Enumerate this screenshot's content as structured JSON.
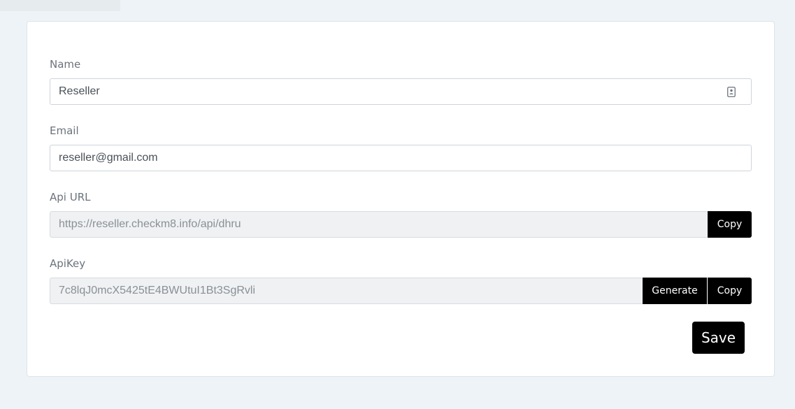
{
  "form": {
    "name": {
      "label": "Name",
      "value": "Reseller"
    },
    "email": {
      "label": "Email",
      "value": "reseller@gmail.com"
    },
    "api_url": {
      "label": "Api URL",
      "value": "https://reseller.checkm8.info/api/dhru",
      "copy_label": "Copy"
    },
    "api_key": {
      "label": "ApiKey",
      "value": "7c8lqJ0mcX5425tE4BWUtuI1Bt3SgRvli",
      "generate_label": "Generate",
      "copy_label": "Copy"
    },
    "save_label": "Save"
  }
}
